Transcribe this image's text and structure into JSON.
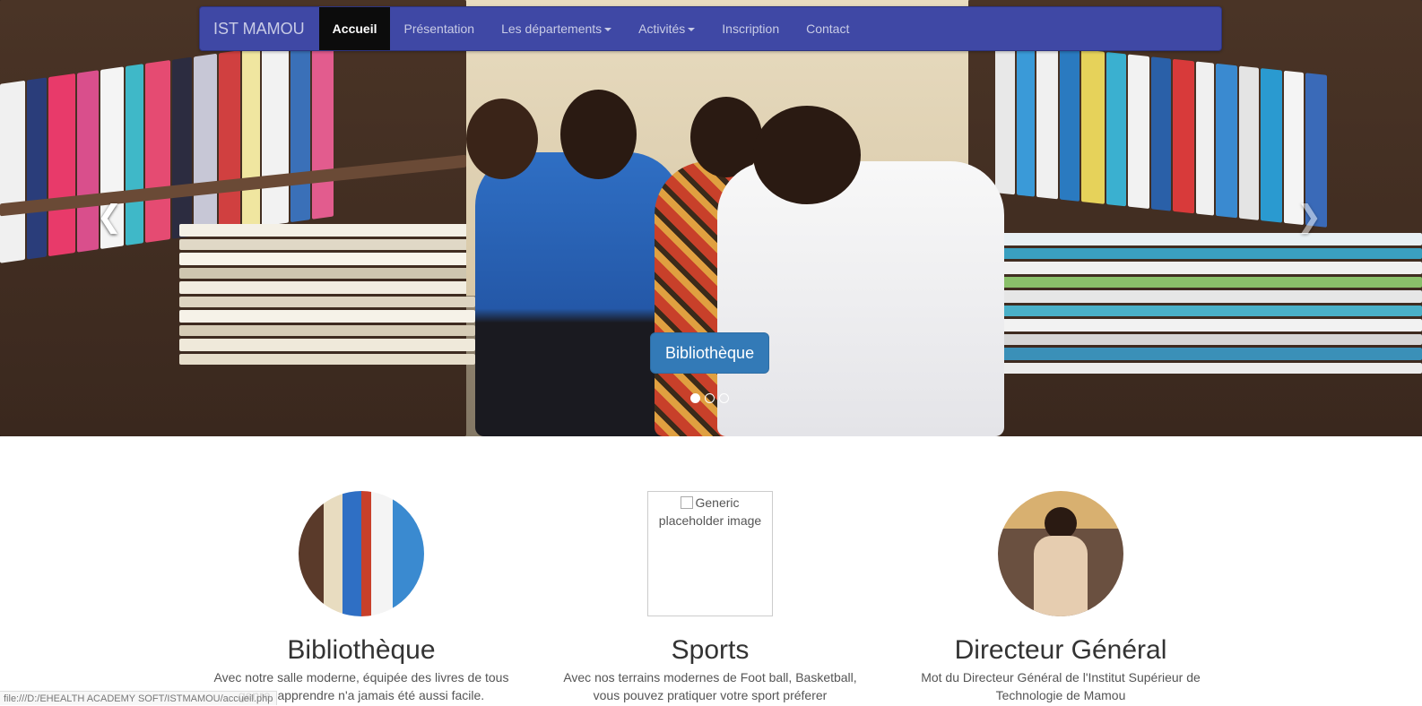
{
  "navbar": {
    "brand": "IST MAMOU",
    "items": [
      {
        "label": "Accueil",
        "active": true,
        "dropdown": false
      },
      {
        "label": "Présentation",
        "active": false,
        "dropdown": false
      },
      {
        "label": "Les départements",
        "active": false,
        "dropdown": true
      },
      {
        "label": "Activités",
        "active": false,
        "dropdown": true
      },
      {
        "label": "Inscription",
        "active": false,
        "dropdown": false
      },
      {
        "label": "Contact",
        "active": false,
        "dropdown": false
      }
    ],
    "color": "#3f48a5"
  },
  "carousel": {
    "prev_icon": "chevron-left-icon",
    "next_icon": "chevron-right-icon",
    "prev_glyph": "❮",
    "next_glyph": "❯",
    "caption_button": "Bibliothèque",
    "slide_count": 3,
    "active_slide": 1
  },
  "marketing": [
    {
      "title": "Bibliothèque",
      "text": "Avec notre salle moderne, équipée des livres de tous genre, apprendre n'a jamais été aussi facile."
    },
    {
      "title": "Sports",
      "image_alt": "Generic placeholder image",
      "text": "Avec nos terrains modernes de Foot ball, Basketball, vous pouvez pratiquer votre sport préferer"
    },
    {
      "title": "Directeur Général",
      "text": "Mot du Directeur Général de l'Institut Supérieur de Technologie de Mamou"
    }
  ],
  "status_bar": "file:///D:/EHEALTH ACADEMY SOFT/ISTMAMOU/accueil.php"
}
